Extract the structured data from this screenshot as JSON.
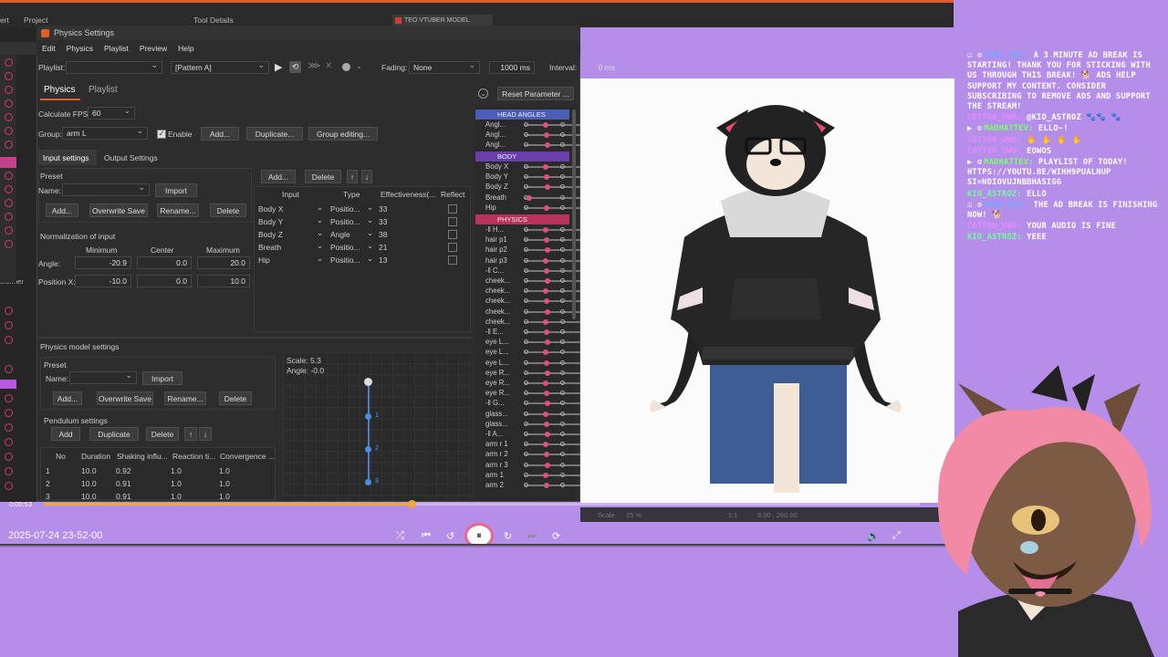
{
  "menu": {
    "items": [
      "Edit",
      "Physics",
      "Playlist",
      "Preview",
      "Help"
    ]
  },
  "titlebar": {
    "title": "Physics Settings",
    "top_tabs": [
      "ert",
      "Project",
      "Tool Details",
      "TEO VTUBER MODEL"
    ],
    "side_label": "eformer"
  },
  "toolbar": {
    "playlist_label": "Playlist:",
    "pattern": "[Pattern A]",
    "fading_label": "Fading:",
    "fading_value": "None",
    "ms_value": "1000 ms",
    "interval_label": "Interval:",
    "interval_value": "0 ms"
  },
  "tabs": {
    "physics": "Physics",
    "playlist": "Playlist",
    "reset": "Reset Parameter ..."
  },
  "settings": {
    "fps_label": "Calculate FPS:",
    "fps_value": "60",
    "group_label": "Group:",
    "group_value": "arm L",
    "enable_label": "Enable",
    "add": "Add...",
    "duplicate": "Duplicate...",
    "group_editing": "Group editing..."
  },
  "subtabs": {
    "input": "Input settings",
    "output": "Output Settings"
  },
  "preset": {
    "title": "Preset",
    "name_label": "Name:",
    "import": "Import",
    "add": "Add...",
    "overwrite": "Overwrite Save",
    "rename": "Rename...",
    "delete": "Delete"
  },
  "normalization": {
    "title": "Normalization of input",
    "min": "Minimum",
    "center": "Center",
    "max": "Maximum",
    "angle_label": "Angle:",
    "angle": [
      "-20.9",
      "0.0",
      "20.0"
    ],
    "posx_label": "Position X:",
    "posx": [
      "-10.0",
      "0.0",
      "10.0"
    ]
  },
  "input_table": {
    "add": "Add...",
    "delete": "Delete",
    "up": "↑",
    "down": "↓",
    "headers": [
      "Input",
      "Type",
      "Effectiveness(...",
      "Reflect"
    ],
    "rows": [
      [
        "Body X",
        "Positio...",
        "33"
      ],
      [
        "Body Y",
        "Positio...",
        "33"
      ],
      [
        "Body Z",
        "Angle",
        "38"
      ],
      [
        "Breath",
        "Positio...",
        "21"
      ],
      [
        "Hip",
        "Positio...",
        "13"
      ]
    ]
  },
  "model": {
    "title": "Physics model settings",
    "preset": "Preset",
    "name_label": "Name:",
    "import": "Import",
    "add": "Add...",
    "overwrite": "Overwrite Save",
    "rename": "Rename...",
    "delete": "Delete",
    "pendulum": "Pendulum settings",
    "p_add": "Add",
    "p_dup": "Duplicate",
    "p_del": "Delete",
    "up": "↑",
    "down": "↓",
    "headers": [
      "No",
      "Duration",
      "Shaking influ...",
      "Reaction ti...",
      "Convergence ..."
    ],
    "rows": [
      [
        "1",
        "10.0",
        "0.92",
        "1.0",
        "1.0"
      ],
      [
        "2",
        "10.0",
        "0.91",
        "1.0",
        "1.0"
      ],
      [
        "3",
        "10.0",
        "0.91",
        "1.0",
        "1.0"
      ]
    ],
    "scale": "Scale: 5.3",
    "angle": "Angle: -0.0",
    "nodes": [
      "1",
      "2",
      "3"
    ]
  },
  "param_panel": {
    "sections": [
      "HEAD ANGLES",
      "BODY",
      "PHYSICS"
    ],
    "head": [
      "Angl...",
      "Angl...",
      "Angl..."
    ],
    "body": [
      "Body X",
      "Body Y",
      "Body Z",
      "Breath",
      "Hip"
    ],
    "physics": [
      "-‖ H...",
      "hair p1",
      "hair p2",
      "hair p3",
      "-‖ C...",
      "cheek...",
      "cheek...",
      "cheek...",
      "cheek...",
      "cheek...",
      "-‖ E...",
      "eye L...",
      "eye L...",
      "eye L...",
      "eye R...",
      "eye R...",
      "eye R...",
      "-‖ G...",
      "glass...",
      "glass...",
      "-‖ A...",
      "arm r 1",
      "arm r 2",
      "arm r 3",
      "arm 1",
      "arm 2"
    ]
  },
  "video": {
    "time": "0:00:53",
    "progress": 0.42,
    "timestamp": "2025-07-24 23-52-00",
    "scale_label": "Scale",
    "scale_value": "25 %",
    "coord": "3.00 , 260.00",
    "ratio": "1:1"
  },
  "chat": [
    {
      "user": "SERV_BOT:",
      "color": "#6fa8ff",
      "msg": "A 3 MINUTE AD BREAK IS STARTING! THANK YOU FOR STICKING WITH US THROUGH THIS BREAK! 🐕 ADS HELP SUPPORT MY CONTENT. CONSIDER SUBSCRIBING TO REMOVE ADS AND SUPPORT THE STREAM!",
      "badges": "☑ ⚙"
    },
    {
      "user": "COTTON_UWU:",
      "color": "#e88aff",
      "msg": "@KIO_ASTROZ 🐾🐾 🐾",
      "badges": ""
    },
    {
      "user": "MADHATTEV:",
      "color": "#7dff6a",
      "msg": "ELLO~!",
      "badges": "▶ ⚙"
    },
    {
      "user": "COTTON_UWU:",
      "color": "#e88aff",
      "msg": "✋ ✋ ✋ ✋",
      "badges": ""
    },
    {
      "user": "COTTON_UWU:",
      "color": "#e88aff",
      "msg": "EOWOS",
      "badges": ""
    },
    {
      "user": "MADHATTEV:",
      "color": "#7dff6a",
      "msg": "PLAYLIST OF TODAY! HTTPS://YOUTU.BE/WIHH9PUALNUP SI=NDIOVUJNBBHASIGG",
      "badges": "▶ ⚙"
    },
    {
      "user": "KIO_ASTROZ:",
      "color": "#6fff9a",
      "msg": "ELLO",
      "badges": ""
    },
    {
      "user": "SERV_BOT:",
      "color": "#6fa8ff",
      "msg": "THE AD BREAK IS FINISHING NOW! 🐕",
      "badges": "☑ ⚙"
    },
    {
      "user": "COTTON_UWU:",
      "color": "#e88aff",
      "msg": "YOUR AUDIO IS FINE",
      "badges": ""
    },
    {
      "user": "KIO_ASTROZ:",
      "color": "#6fff9a",
      "msg": "YEEE",
      "badges": ""
    }
  ]
}
